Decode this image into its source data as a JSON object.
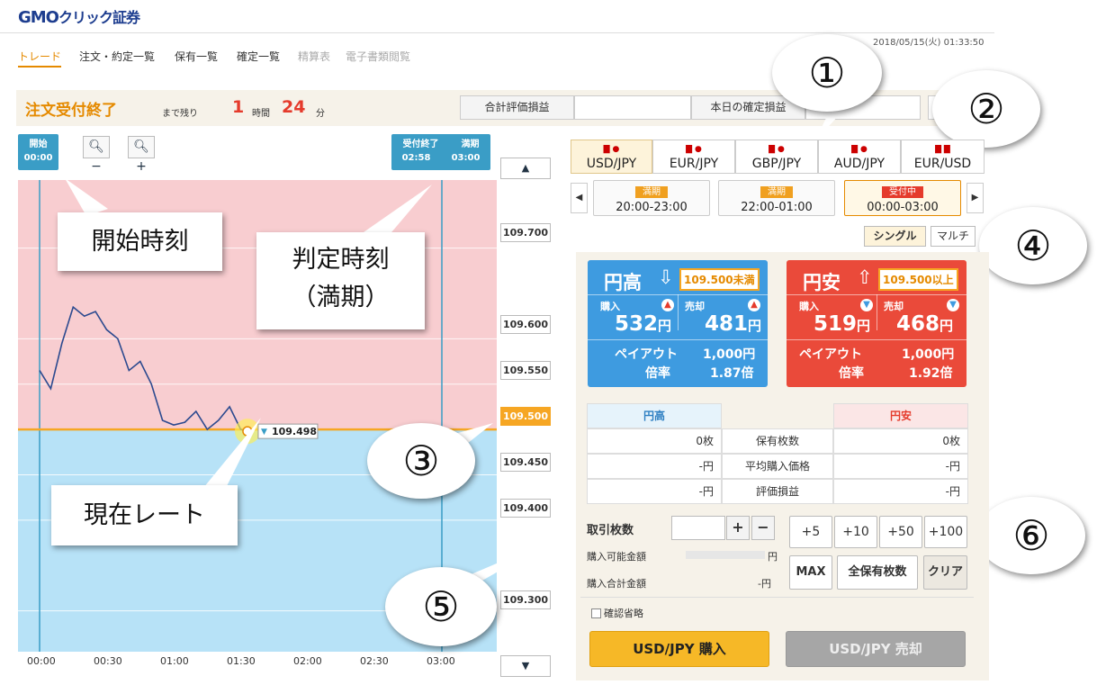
{
  "logo": {
    "main": "GMO",
    "tail": "クリック証券"
  },
  "datetime": "2018/05/15(火) 01:33:50",
  "nav": [
    {
      "label": "トレード",
      "active": true
    },
    {
      "label": "注文・約定一覧"
    },
    {
      "label": "保有一覧"
    },
    {
      "label": "確定一覧"
    },
    {
      "label": "精算表",
      "dim": true
    },
    {
      "label": "電子書類閲覧",
      "dim": true
    }
  ],
  "status": {
    "title": "注文受付終了",
    "remain_label": "まで残り",
    "hours": "1",
    "hours_unit": "時間",
    "minutes": "24",
    "minutes_unit": "分",
    "pl_total_label": "合計評価損益",
    "pl_today_label": "本日の確定損益"
  },
  "chart": {
    "start_flag": {
      "label": "開始",
      "time": "00:00"
    },
    "end_flag": {
      "label1": "受付終了",
      "label2": "満期",
      "time1": "02:58",
      "time2": "03:00"
    },
    "zoom_out_icon": "zoom-out-icon",
    "zoom_in_icon": "zoom-in-icon",
    "current_rate": "109.498",
    "price_labels": [
      "109.700",
      "109.600",
      "109.550",
      "109.500",
      "109.450",
      "109.400",
      "109.300"
    ],
    "x_labels": [
      "00:00",
      "00:30",
      "01:00",
      "01:30",
      "02:00",
      "02:30",
      "03:00"
    ]
  },
  "chart_data": {
    "type": "line",
    "title": "",
    "xlabel": "",
    "ylabel": "",
    "x": [
      "00:00",
      "00:05",
      "00:10",
      "00:15",
      "00:20",
      "00:25",
      "00:30",
      "00:35",
      "00:40",
      "00:45",
      "00:50",
      "00:55",
      "01:00",
      "01:05",
      "01:10",
      "01:15",
      "01:20",
      "01:25",
      "01:30",
      "01:33"
    ],
    "y": [
      109.565,
      109.545,
      109.595,
      109.635,
      109.625,
      109.63,
      109.61,
      109.6,
      109.565,
      109.575,
      109.55,
      109.51,
      109.505,
      109.508,
      109.52,
      109.5,
      109.51,
      109.525,
      109.5,
      109.498
    ],
    "ylim": [
      109.255,
      109.775
    ],
    "xlim": [
      "00:00",
      "03:00"
    ],
    "threshold": 109.5,
    "colors": {
      "line": "#2c4a8f",
      "above": "#f8cdd0",
      "below": "#b7e2f7",
      "threshold": "#f6a623",
      "marker": "#3a9dc6"
    }
  },
  "callouts": {
    "start": "開始時刻",
    "judge1": "判定時刻",
    "judge2": "（満期）",
    "rate": "現在レート",
    "n1": "①",
    "n2": "②",
    "n3": "③",
    "n4": "④",
    "n5": "⑤",
    "n6": "⑥"
  },
  "pairs": [
    {
      "label": "USD/JPY",
      "flags": "🇺🇸●",
      "selected": true
    },
    {
      "label": "EUR/JPY",
      "flags": "▇●"
    },
    {
      "label": "GBP/JPY",
      "flags": "▇●"
    },
    {
      "label": "AUD/JPY",
      "flags": "▇●"
    },
    {
      "label": "EUR/USD",
      "flags": "▇▇"
    }
  ],
  "schedules": [
    {
      "status": "満期",
      "time": "20:00-23:00"
    },
    {
      "status": "満期",
      "time": "22:00-01:00"
    },
    {
      "status": "受付中",
      "time": "00:00-03:00",
      "selected": true
    }
  ],
  "modes": {
    "single": "シングル",
    "multi": "マルチ"
  },
  "up_card": {
    "title": "円高",
    "arrow": "⇩",
    "threshold": "109.500未満",
    "buy_label": "購入",
    "sell_label": "売却",
    "buy_price": "532",
    "sell_price": "481",
    "yen": "円",
    "payout_label": "ペイアウト",
    "payout": "1,000円",
    "rate_label": "倍率",
    "rate": "1.87倍"
  },
  "down_card": {
    "title": "円安",
    "arrow": "⇧",
    "threshold": "109.500以上",
    "buy_label": "購入",
    "sell_label": "売却",
    "buy_price": "519",
    "sell_price": "468",
    "yen": "円",
    "payout_label": "ペイアウト",
    "payout": "1,000円",
    "rate_label": "倍率",
    "rate": "1.92倍"
  },
  "holdings": {
    "up_header": "円高",
    "down_header": "円安",
    "rows": [
      {
        "label": "保有枚数",
        "up": "0枚",
        "down": "0枚"
      },
      {
        "label": "平均購入価格",
        "up": "-円",
        "down": "-円"
      },
      {
        "label": "評価損益",
        "up": "-円",
        "down": "-円"
      }
    ]
  },
  "order": {
    "qty_label": "取引枚数",
    "plus": "+",
    "minus": "−",
    "available_label": "購入可能金額",
    "available_unit": "円",
    "total_label": "購入合計金額",
    "total_value": "-円",
    "quick": [
      "+5",
      "+10",
      "+50",
      "+100"
    ],
    "max": "MAX",
    "all_holdings": "全保有枚数",
    "clear": "クリア",
    "skip_confirm": "確認省略",
    "buy_btn": "USD/JPY 購入",
    "sell_btn": "USD/JPY 売却"
  }
}
